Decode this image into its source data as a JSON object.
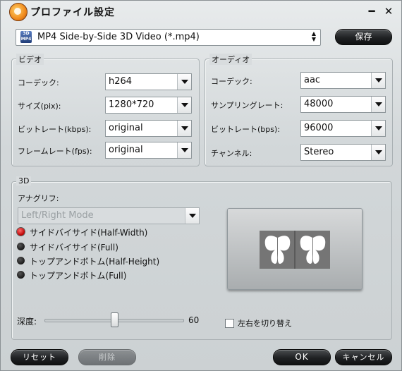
{
  "window": {
    "title": "プロファイル設定",
    "minimize": "━",
    "close": "✕"
  },
  "profile": {
    "value": "MP4 Side-by-Side 3D Video (*.mp4)",
    "icon": "mp4-file-icon",
    "icon_text": "3D MP4",
    "save_label": "保存"
  },
  "video": {
    "legend": "ビデオ",
    "codec": {
      "label": "コーデック:",
      "value": "h264"
    },
    "size": {
      "label": "サイズ(pix):",
      "value": "1280*720"
    },
    "bitrate": {
      "label": "ビットレート(kbps):",
      "value": "original"
    },
    "framerate": {
      "label": "フレームレート(fps):",
      "value": "original"
    }
  },
  "audio": {
    "legend": "オーディオ",
    "codec": {
      "label": "コーデック:",
      "value": "aac"
    },
    "samplerate": {
      "label": "サンプリングレート:",
      "value": "48000"
    },
    "bitrate": {
      "label": "ビットレート(bps):",
      "value": "96000"
    },
    "channel": {
      "label": "チャンネル:",
      "value": "Stereo"
    }
  },
  "three_d": {
    "legend": "3D",
    "anaglyph_label": "アナグリフ:",
    "anaglyph_value": "Left/Right Mode",
    "modes": [
      {
        "label": "サイドバイサイド(Half-Width)",
        "selected": true
      },
      {
        "label": "サイドバイサイド(Full)",
        "selected": false
      },
      {
        "label": "トップアンドボトム(Half-Height)",
        "selected": false
      },
      {
        "label": "トップアンドボトム(Full)",
        "selected": false
      }
    ],
    "depth_label": "深度:",
    "depth_value": "60",
    "swap_label": "左右を切り替え",
    "swap_checked": false
  },
  "footer": {
    "reset": "リセット",
    "delete": "削除",
    "ok": "OK",
    "cancel": "キャンセル"
  },
  "colors": {
    "accent_dark": "#1f2123",
    "selected_radio": "#c40000"
  }
}
